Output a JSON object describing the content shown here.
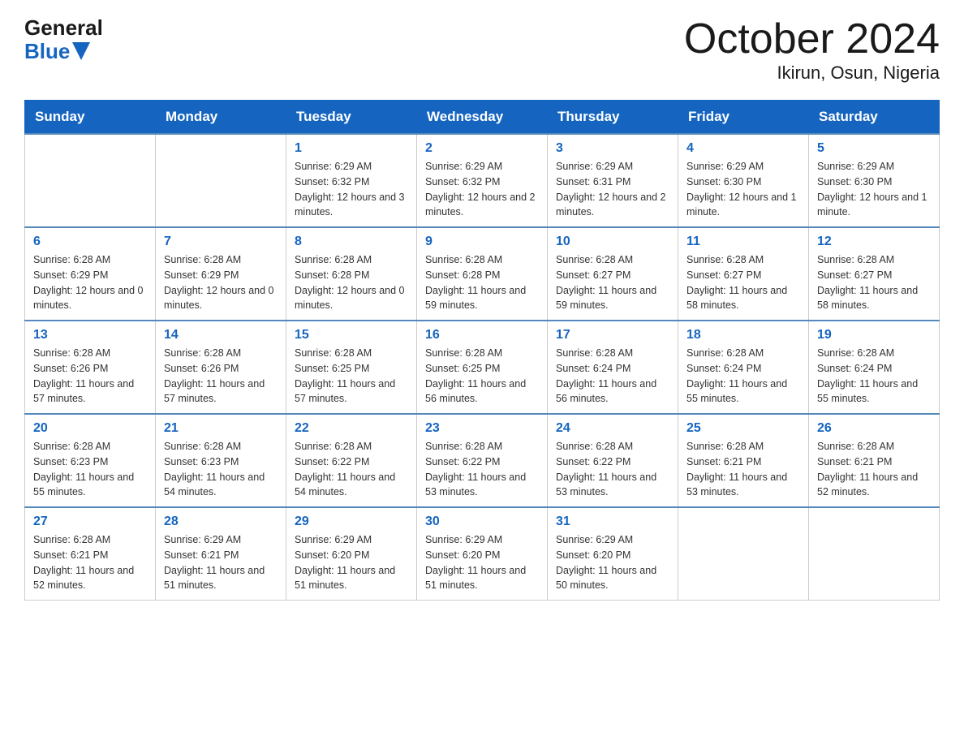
{
  "logo": {
    "general": "General",
    "blue": "Blue"
  },
  "title": {
    "month": "October 2024",
    "location": "Ikirun, Osun, Nigeria"
  },
  "headers": [
    "Sunday",
    "Monday",
    "Tuesday",
    "Wednesday",
    "Thursday",
    "Friday",
    "Saturday"
  ],
  "weeks": [
    [
      {
        "day": "",
        "info": ""
      },
      {
        "day": "",
        "info": ""
      },
      {
        "day": "1",
        "info": "Sunrise: 6:29 AM\nSunset: 6:32 PM\nDaylight: 12 hours and 3 minutes."
      },
      {
        "day": "2",
        "info": "Sunrise: 6:29 AM\nSunset: 6:32 PM\nDaylight: 12 hours and 2 minutes."
      },
      {
        "day": "3",
        "info": "Sunrise: 6:29 AM\nSunset: 6:31 PM\nDaylight: 12 hours and 2 minutes."
      },
      {
        "day": "4",
        "info": "Sunrise: 6:29 AM\nSunset: 6:30 PM\nDaylight: 12 hours and 1 minute."
      },
      {
        "day": "5",
        "info": "Sunrise: 6:29 AM\nSunset: 6:30 PM\nDaylight: 12 hours and 1 minute."
      }
    ],
    [
      {
        "day": "6",
        "info": "Sunrise: 6:28 AM\nSunset: 6:29 PM\nDaylight: 12 hours and 0 minutes."
      },
      {
        "day": "7",
        "info": "Sunrise: 6:28 AM\nSunset: 6:29 PM\nDaylight: 12 hours and 0 minutes."
      },
      {
        "day": "8",
        "info": "Sunrise: 6:28 AM\nSunset: 6:28 PM\nDaylight: 12 hours and 0 minutes."
      },
      {
        "day": "9",
        "info": "Sunrise: 6:28 AM\nSunset: 6:28 PM\nDaylight: 11 hours and 59 minutes."
      },
      {
        "day": "10",
        "info": "Sunrise: 6:28 AM\nSunset: 6:27 PM\nDaylight: 11 hours and 59 minutes."
      },
      {
        "day": "11",
        "info": "Sunrise: 6:28 AM\nSunset: 6:27 PM\nDaylight: 11 hours and 58 minutes."
      },
      {
        "day": "12",
        "info": "Sunrise: 6:28 AM\nSunset: 6:27 PM\nDaylight: 11 hours and 58 minutes."
      }
    ],
    [
      {
        "day": "13",
        "info": "Sunrise: 6:28 AM\nSunset: 6:26 PM\nDaylight: 11 hours and 57 minutes."
      },
      {
        "day": "14",
        "info": "Sunrise: 6:28 AM\nSunset: 6:26 PM\nDaylight: 11 hours and 57 minutes."
      },
      {
        "day": "15",
        "info": "Sunrise: 6:28 AM\nSunset: 6:25 PM\nDaylight: 11 hours and 57 minutes."
      },
      {
        "day": "16",
        "info": "Sunrise: 6:28 AM\nSunset: 6:25 PM\nDaylight: 11 hours and 56 minutes."
      },
      {
        "day": "17",
        "info": "Sunrise: 6:28 AM\nSunset: 6:24 PM\nDaylight: 11 hours and 56 minutes."
      },
      {
        "day": "18",
        "info": "Sunrise: 6:28 AM\nSunset: 6:24 PM\nDaylight: 11 hours and 55 minutes."
      },
      {
        "day": "19",
        "info": "Sunrise: 6:28 AM\nSunset: 6:24 PM\nDaylight: 11 hours and 55 minutes."
      }
    ],
    [
      {
        "day": "20",
        "info": "Sunrise: 6:28 AM\nSunset: 6:23 PM\nDaylight: 11 hours and 55 minutes."
      },
      {
        "day": "21",
        "info": "Sunrise: 6:28 AM\nSunset: 6:23 PM\nDaylight: 11 hours and 54 minutes."
      },
      {
        "day": "22",
        "info": "Sunrise: 6:28 AM\nSunset: 6:22 PM\nDaylight: 11 hours and 54 minutes."
      },
      {
        "day": "23",
        "info": "Sunrise: 6:28 AM\nSunset: 6:22 PM\nDaylight: 11 hours and 53 minutes."
      },
      {
        "day": "24",
        "info": "Sunrise: 6:28 AM\nSunset: 6:22 PM\nDaylight: 11 hours and 53 minutes."
      },
      {
        "day": "25",
        "info": "Sunrise: 6:28 AM\nSunset: 6:21 PM\nDaylight: 11 hours and 53 minutes."
      },
      {
        "day": "26",
        "info": "Sunrise: 6:28 AM\nSunset: 6:21 PM\nDaylight: 11 hours and 52 minutes."
      }
    ],
    [
      {
        "day": "27",
        "info": "Sunrise: 6:28 AM\nSunset: 6:21 PM\nDaylight: 11 hours and 52 minutes."
      },
      {
        "day": "28",
        "info": "Sunrise: 6:29 AM\nSunset: 6:21 PM\nDaylight: 11 hours and 51 minutes."
      },
      {
        "day": "29",
        "info": "Sunrise: 6:29 AM\nSunset: 6:20 PM\nDaylight: 11 hours and 51 minutes."
      },
      {
        "day": "30",
        "info": "Sunrise: 6:29 AM\nSunset: 6:20 PM\nDaylight: 11 hours and 51 minutes."
      },
      {
        "day": "31",
        "info": "Sunrise: 6:29 AM\nSunset: 6:20 PM\nDaylight: 11 hours and 50 minutes."
      },
      {
        "day": "",
        "info": ""
      },
      {
        "day": "",
        "info": ""
      }
    ]
  ]
}
